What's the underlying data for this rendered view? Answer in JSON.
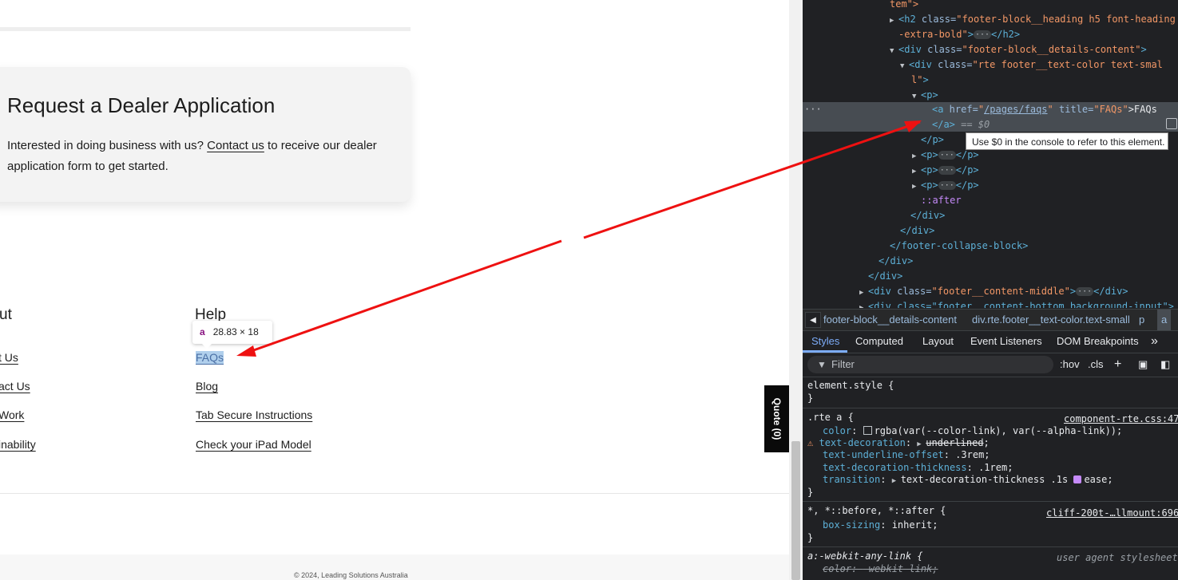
{
  "page": {
    "dealer_card": {
      "title": "Request a Dealer Application",
      "text_before": "Interested in doing business with us? ",
      "link": "Contact us",
      "text_after": " to receive our dealer application form to get started."
    },
    "about_col": {
      "heading": "ut",
      "links": [
        "t Us",
        "act Us",
        "Work",
        "inability"
      ]
    },
    "help_col": {
      "heading": "Help",
      "links": [
        "FAQs",
        "Blog",
        "Tab Secure Instructions",
        "Check your iPad Model"
      ]
    },
    "inspector_tooltip": {
      "tag": "a",
      "size": "28.83 × 18"
    },
    "quote_tab": "Quote (0)",
    "copyright": "© 2024, Leading Solutions Australia",
    "colors": {
      "highlight": "#6fa8dc",
      "arrow": "#ee1111",
      "quote_bg": "#0a0a0a"
    }
  },
  "devtools": {
    "dom": {
      "l0": "tem\">",
      "l1_tag": "<h2",
      "l1_attr": " class=",
      "l1_val": "\"footer-block__heading h5 font-heading",
      "l2_val": "-extra-bold\"",
      "l2_end": "</h2>",
      "l3_tag": "<div",
      "l3_attr": " class=",
      "l3_val": "\"footer-block__details-content\"",
      "l3_end": ">",
      "l4_tag": "<div",
      "l4_attr": " class=",
      "l4_val": "\"rte footer__text-color text-smal",
      "l5_val": "l\"",
      "l5_end": ">",
      "l6": "<p>",
      "l7_tag": "<a",
      "l7_attr1": " href=",
      "l7_href": "/pages/faqs",
      "l7_attr2": " title=",
      "l7_title": "\"FAQs\"",
      "l7_text": ">FAQs",
      "l8_close": "</a>",
      "l8_eq": " == $0",
      "l9": "</p>",
      "l10_open": "<p>",
      "l10_close": "</p>",
      "l13": "::after",
      "l14": "</div>",
      "l15": "</div>",
      "l16": "</footer-collapse-block>",
      "l17": "</div>",
      "l18": "</div>",
      "l19_tag": "<div",
      "l19_attr": " class=",
      "l19_val": "\"footer__content-middle\"",
      "l19_end": "</div>",
      "l20": "<div class=\"footer__content-bottom background-input\">"
    },
    "dollar_tooltip": "Use $0 in the console to refer to this element.",
    "breadcrumbs": {
      "items": [
        "footer-block__details-content",
        "div.rte.footer__text-color.text-small",
        "p",
        "a"
      ]
    },
    "tabs": [
      "Styles",
      "Computed",
      "Layout",
      "Event Listeners",
      "DOM Breakpoints"
    ],
    "tabs_more": "»",
    "filter_placeholder": "Filter",
    "filter_buttons": [
      ":hov",
      ".cls",
      "+"
    ],
    "styles": {
      "element_style": "element.style {",
      "close": "}",
      "rte_selector": ".rte a {",
      "rte_source": "component-rte.css:47",
      "color_prop": "color",
      "color_val": "rgba(var(--color-link), var(--alpha-link));",
      "td_prop": "text-decoration",
      "td_val": "underlined",
      "tuo_prop": "text-underline-offset",
      "tuo_val": ".3rem;",
      "tdt_prop": "text-decoration-thickness",
      "tdt_val": ".1rem;",
      "tr_prop": "transition",
      "tr_val": "text-decoration-thickness .1s",
      "tr_ease": "ease;",
      "star_selector": "*, *::before, *::after {",
      "star_source": "cliff-200t-…llmount:696",
      "bs_prop": "box-sizing",
      "bs_val": "inherit;",
      "any_link": "a:-webkit-any-link {",
      "ua_source": "user agent stylesheet",
      "ua_color_prop": "color",
      "ua_color_val": "-webkit-link;"
    }
  }
}
